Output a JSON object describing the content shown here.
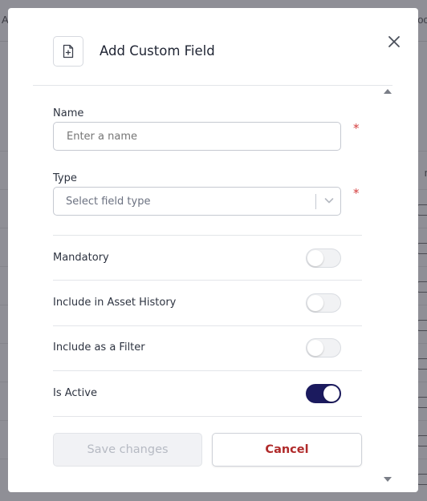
{
  "background": {
    "header_left_fragment": "A",
    "header_right_fragment": "oc",
    "column_header_fragment": "n"
  },
  "modal": {
    "title": "Add Custom Field",
    "icon": "file-plus-icon",
    "close_icon": "close-icon",
    "fields": {
      "name": {
        "label": "Name",
        "placeholder": "Enter a name",
        "value": "",
        "required_mark": "*"
      },
      "type": {
        "label": "Type",
        "placeholder": "Select field type",
        "required_mark": "*"
      }
    },
    "toggles": [
      {
        "label": "Mandatory",
        "on": false
      },
      {
        "label": "Include in Asset History",
        "on": false
      },
      {
        "label": "Include as a Filter",
        "on": false
      },
      {
        "label": "Is Active",
        "on": true
      }
    ],
    "buttons": {
      "save_label": "Save changes",
      "cancel_label": "Cancel"
    }
  },
  "colors": {
    "accent": "#1b1a5e",
    "danger": "#b02a2a",
    "required": "#d43c3c",
    "overlay": "#8f8f96"
  }
}
